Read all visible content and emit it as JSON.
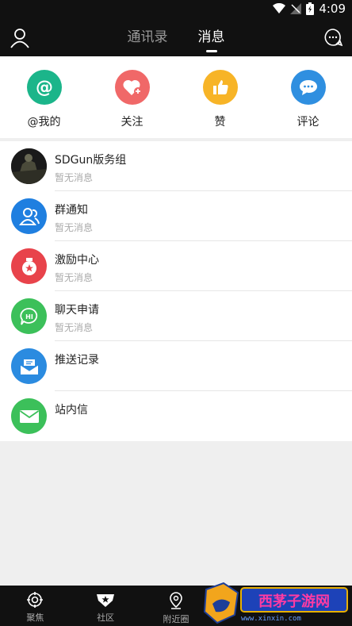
{
  "status_bar": {
    "time": "4:09"
  },
  "header": {
    "tabs": [
      {
        "label": "通讯录",
        "active": false
      },
      {
        "label": "消息",
        "active": true
      }
    ]
  },
  "quick_actions": [
    {
      "label": "@我的",
      "icon": "at-icon",
      "color": "#1bb58a"
    },
    {
      "label": "关注",
      "icon": "heart-plus-icon",
      "color": "#f06868"
    },
    {
      "label": "赞",
      "icon": "thumbs-up-icon",
      "color": "#f7b427"
    },
    {
      "label": "评论",
      "icon": "comment-icon",
      "color": "#2f8fe0"
    }
  ],
  "messages": [
    {
      "title": "SDGun版务组",
      "subtitle": "暂无消息",
      "icon": "group-photo-avatar"
    },
    {
      "title": "群通知",
      "subtitle": "暂无消息",
      "icon": "group-notice-icon",
      "color": "#1f7fe0"
    },
    {
      "title": "激励中心",
      "subtitle": "暂无消息",
      "icon": "reward-center-icon",
      "color": "#e8434b"
    },
    {
      "title": "聊天申请",
      "subtitle": "暂无消息",
      "icon": "chat-request-icon",
      "color": "#3cc05a"
    },
    {
      "title": "推送记录",
      "subtitle": "",
      "icon": "push-record-icon",
      "color": "#2b8be0"
    },
    {
      "title": "站内信",
      "subtitle": "",
      "icon": "mail-icon",
      "color": "#3cc05a"
    }
  ],
  "bottom_nav": [
    {
      "label": "聚焦",
      "icon": "target-icon"
    },
    {
      "label": "社区",
      "icon": "community-icon"
    },
    {
      "label": "附近圈",
      "icon": "location-icon"
    },
    {
      "label": "",
      "icon": "nav-item-icon"
    },
    {
      "label": "",
      "icon": "nav-item-icon"
    }
  ],
  "watermark": {
    "text": "西茅子游网",
    "site": "www.xinxin.com"
  }
}
